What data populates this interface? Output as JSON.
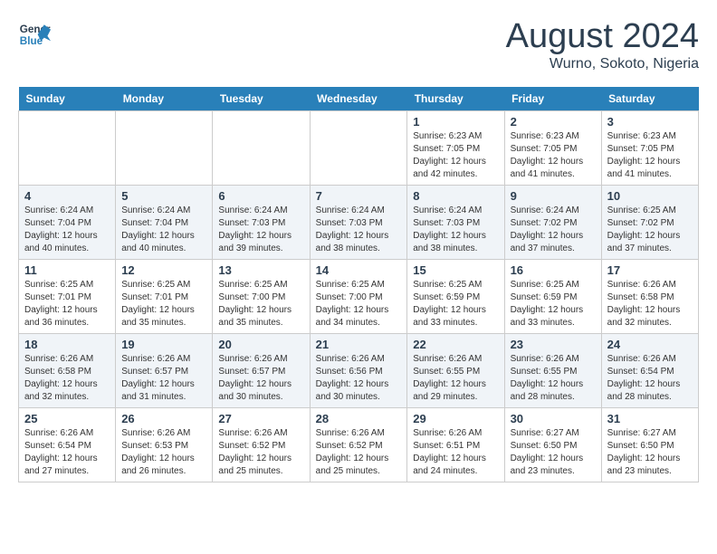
{
  "header": {
    "logo_line1": "General",
    "logo_line2": "Blue",
    "title": "August 2024",
    "subtitle": "Wurno, Sokoto, Nigeria"
  },
  "weekdays": [
    "Sunday",
    "Monday",
    "Tuesday",
    "Wednesday",
    "Thursday",
    "Friday",
    "Saturday"
  ],
  "weeks": [
    [
      {
        "day": "",
        "info": ""
      },
      {
        "day": "",
        "info": ""
      },
      {
        "day": "",
        "info": ""
      },
      {
        "day": "",
        "info": ""
      },
      {
        "day": "1",
        "info": "Sunrise: 6:23 AM\nSunset: 7:05 PM\nDaylight: 12 hours\nand 42 minutes."
      },
      {
        "day": "2",
        "info": "Sunrise: 6:23 AM\nSunset: 7:05 PM\nDaylight: 12 hours\nand 41 minutes."
      },
      {
        "day": "3",
        "info": "Sunrise: 6:23 AM\nSunset: 7:05 PM\nDaylight: 12 hours\nand 41 minutes."
      }
    ],
    [
      {
        "day": "4",
        "info": "Sunrise: 6:24 AM\nSunset: 7:04 PM\nDaylight: 12 hours\nand 40 minutes."
      },
      {
        "day": "5",
        "info": "Sunrise: 6:24 AM\nSunset: 7:04 PM\nDaylight: 12 hours\nand 40 minutes."
      },
      {
        "day": "6",
        "info": "Sunrise: 6:24 AM\nSunset: 7:03 PM\nDaylight: 12 hours\nand 39 minutes."
      },
      {
        "day": "7",
        "info": "Sunrise: 6:24 AM\nSunset: 7:03 PM\nDaylight: 12 hours\nand 38 minutes."
      },
      {
        "day": "8",
        "info": "Sunrise: 6:24 AM\nSunset: 7:03 PM\nDaylight: 12 hours\nand 38 minutes."
      },
      {
        "day": "9",
        "info": "Sunrise: 6:24 AM\nSunset: 7:02 PM\nDaylight: 12 hours\nand 37 minutes."
      },
      {
        "day": "10",
        "info": "Sunrise: 6:25 AM\nSunset: 7:02 PM\nDaylight: 12 hours\nand 37 minutes."
      }
    ],
    [
      {
        "day": "11",
        "info": "Sunrise: 6:25 AM\nSunset: 7:01 PM\nDaylight: 12 hours\nand 36 minutes."
      },
      {
        "day": "12",
        "info": "Sunrise: 6:25 AM\nSunset: 7:01 PM\nDaylight: 12 hours\nand 35 minutes."
      },
      {
        "day": "13",
        "info": "Sunrise: 6:25 AM\nSunset: 7:00 PM\nDaylight: 12 hours\nand 35 minutes."
      },
      {
        "day": "14",
        "info": "Sunrise: 6:25 AM\nSunset: 7:00 PM\nDaylight: 12 hours\nand 34 minutes."
      },
      {
        "day": "15",
        "info": "Sunrise: 6:25 AM\nSunset: 6:59 PM\nDaylight: 12 hours\nand 33 minutes."
      },
      {
        "day": "16",
        "info": "Sunrise: 6:25 AM\nSunset: 6:59 PM\nDaylight: 12 hours\nand 33 minutes."
      },
      {
        "day": "17",
        "info": "Sunrise: 6:26 AM\nSunset: 6:58 PM\nDaylight: 12 hours\nand 32 minutes."
      }
    ],
    [
      {
        "day": "18",
        "info": "Sunrise: 6:26 AM\nSunset: 6:58 PM\nDaylight: 12 hours\nand 32 minutes."
      },
      {
        "day": "19",
        "info": "Sunrise: 6:26 AM\nSunset: 6:57 PM\nDaylight: 12 hours\nand 31 minutes."
      },
      {
        "day": "20",
        "info": "Sunrise: 6:26 AM\nSunset: 6:57 PM\nDaylight: 12 hours\nand 30 minutes."
      },
      {
        "day": "21",
        "info": "Sunrise: 6:26 AM\nSunset: 6:56 PM\nDaylight: 12 hours\nand 30 minutes."
      },
      {
        "day": "22",
        "info": "Sunrise: 6:26 AM\nSunset: 6:55 PM\nDaylight: 12 hours\nand 29 minutes."
      },
      {
        "day": "23",
        "info": "Sunrise: 6:26 AM\nSunset: 6:55 PM\nDaylight: 12 hours\nand 28 minutes."
      },
      {
        "day": "24",
        "info": "Sunrise: 6:26 AM\nSunset: 6:54 PM\nDaylight: 12 hours\nand 28 minutes."
      }
    ],
    [
      {
        "day": "25",
        "info": "Sunrise: 6:26 AM\nSunset: 6:54 PM\nDaylight: 12 hours\nand 27 minutes."
      },
      {
        "day": "26",
        "info": "Sunrise: 6:26 AM\nSunset: 6:53 PM\nDaylight: 12 hours\nand 26 minutes."
      },
      {
        "day": "27",
        "info": "Sunrise: 6:26 AM\nSunset: 6:52 PM\nDaylight: 12 hours\nand 25 minutes."
      },
      {
        "day": "28",
        "info": "Sunrise: 6:26 AM\nSunset: 6:52 PM\nDaylight: 12 hours\nand 25 minutes."
      },
      {
        "day": "29",
        "info": "Sunrise: 6:26 AM\nSunset: 6:51 PM\nDaylight: 12 hours\nand 24 minutes."
      },
      {
        "day": "30",
        "info": "Sunrise: 6:27 AM\nSunset: 6:50 PM\nDaylight: 12 hours\nand 23 minutes."
      },
      {
        "day": "31",
        "info": "Sunrise: 6:27 AM\nSunset: 6:50 PM\nDaylight: 12 hours\nand 23 minutes."
      }
    ]
  ]
}
